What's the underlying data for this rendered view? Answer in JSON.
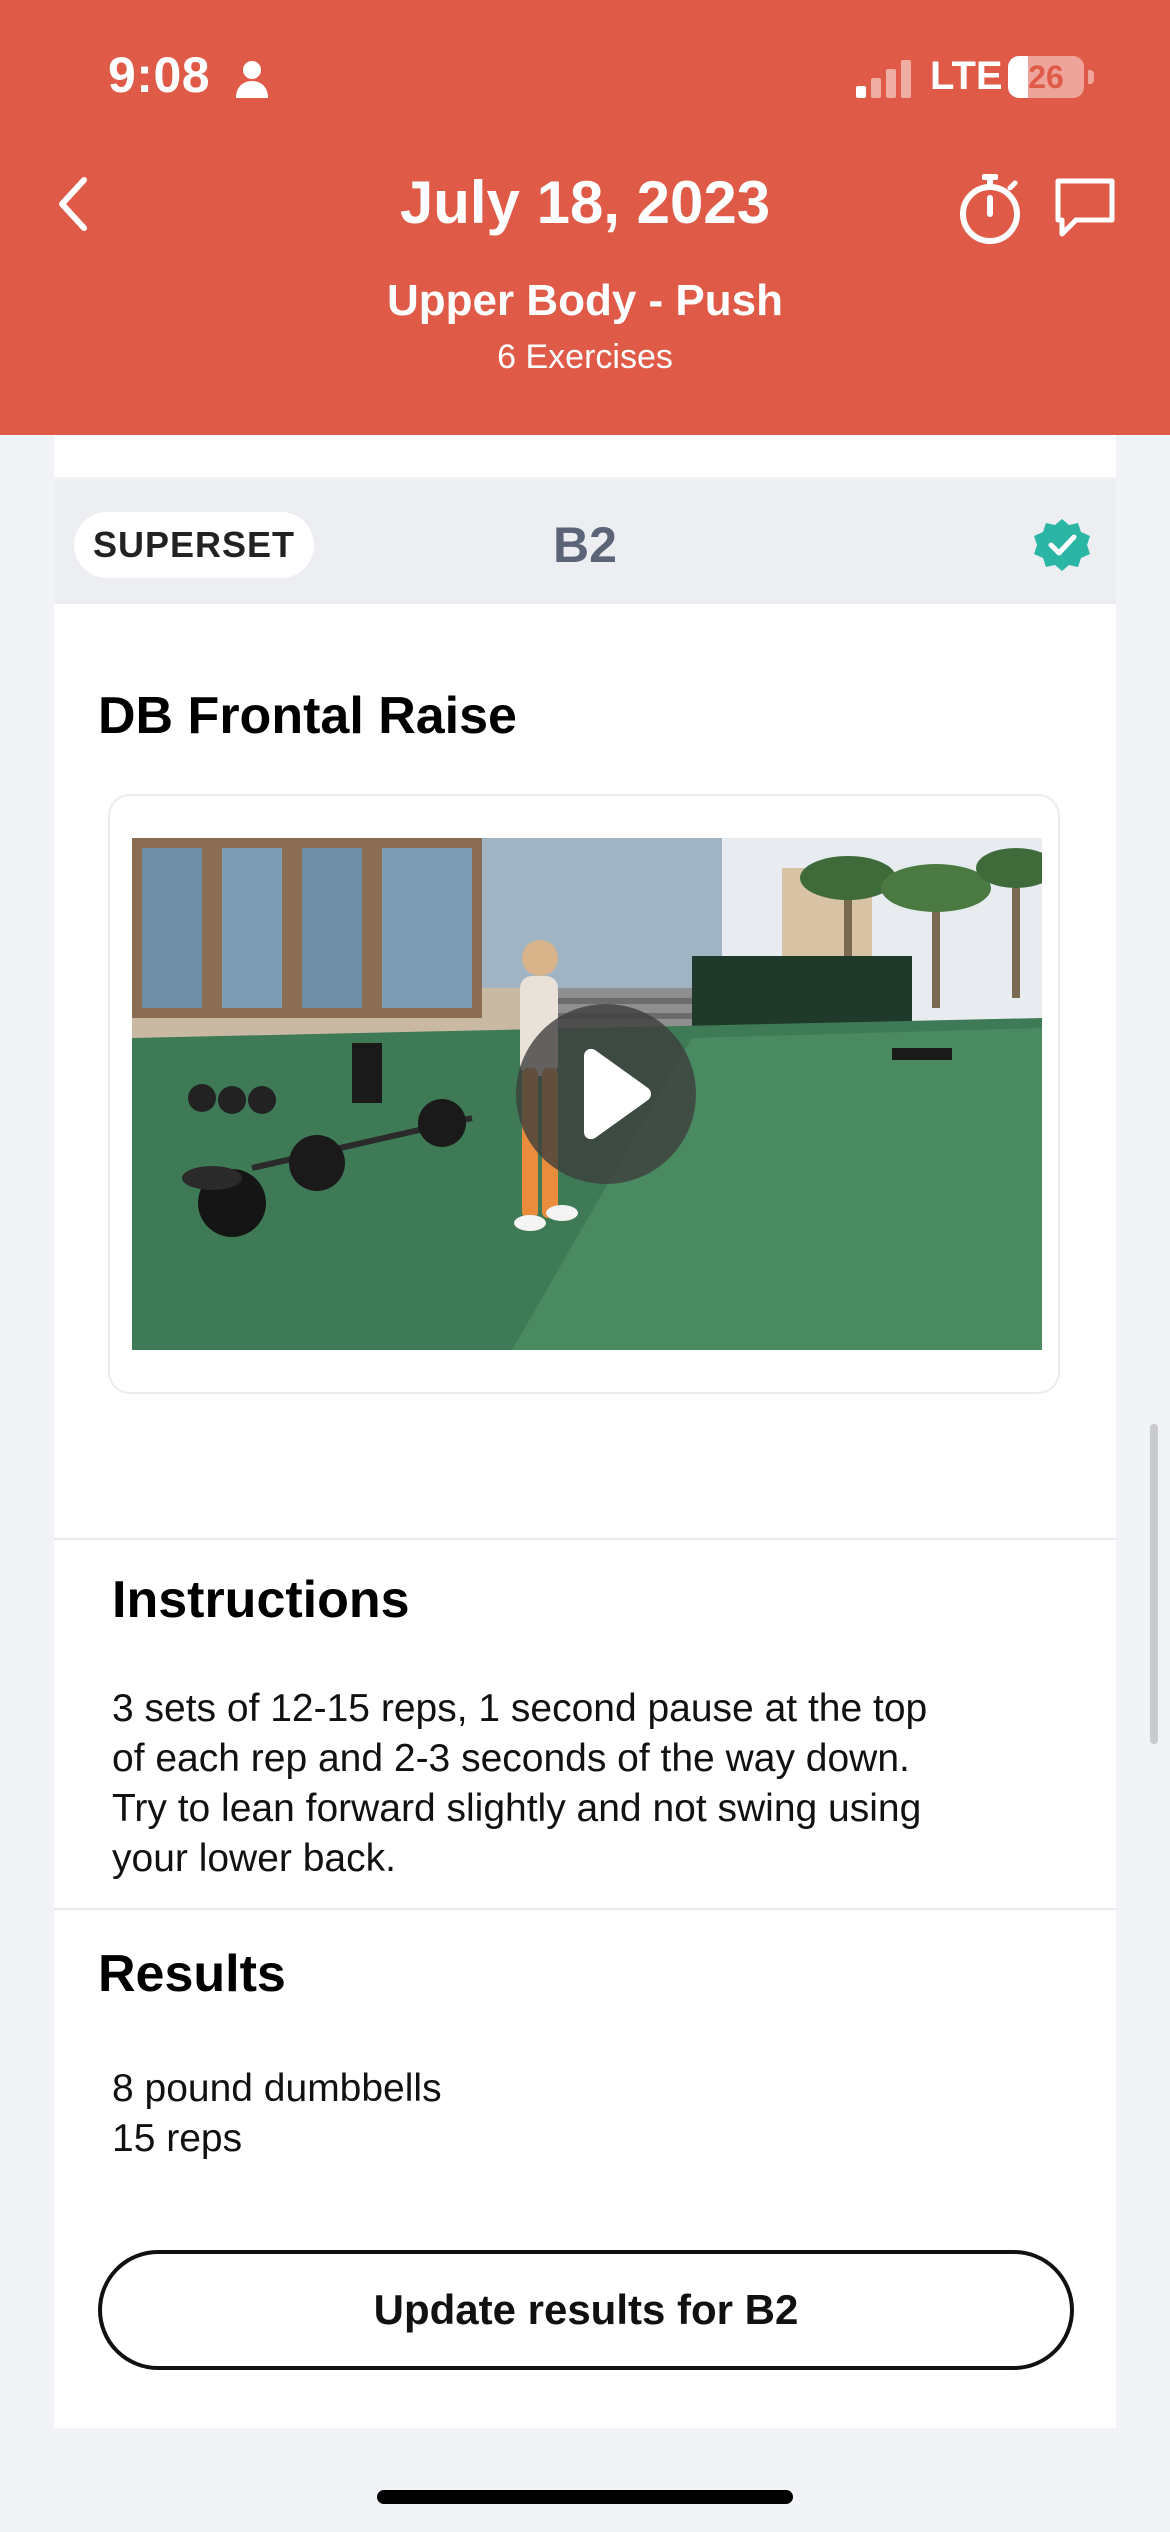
{
  "status_bar": {
    "time": "9:08",
    "network": "LTE",
    "battery_level": "26"
  },
  "header": {
    "date": "July 18, 2023",
    "workout_name": "Upper Body - Push",
    "exercise_count": "6 Exercises",
    "background_color": "#e05a48"
  },
  "superset": {
    "badge_label": "SUPERSET",
    "code": "B2",
    "completed_color": "#2bb5a4"
  },
  "exercise": {
    "title": "DB Frontal Raise",
    "video_play_icon": "play-icon"
  },
  "instructions": {
    "heading": "Instructions",
    "lines": [
      "3 sets of 12-15 reps, 1 second pause at the top",
      "of each rep and 2-3 seconds of the way down.",
      "Try to lean forward slightly and not swing using",
      "your lower back."
    ]
  },
  "results": {
    "heading": "Results",
    "lines": [
      "8 pound dumbbells",
      "15 reps"
    ],
    "update_button_label": "Update results for B2"
  }
}
